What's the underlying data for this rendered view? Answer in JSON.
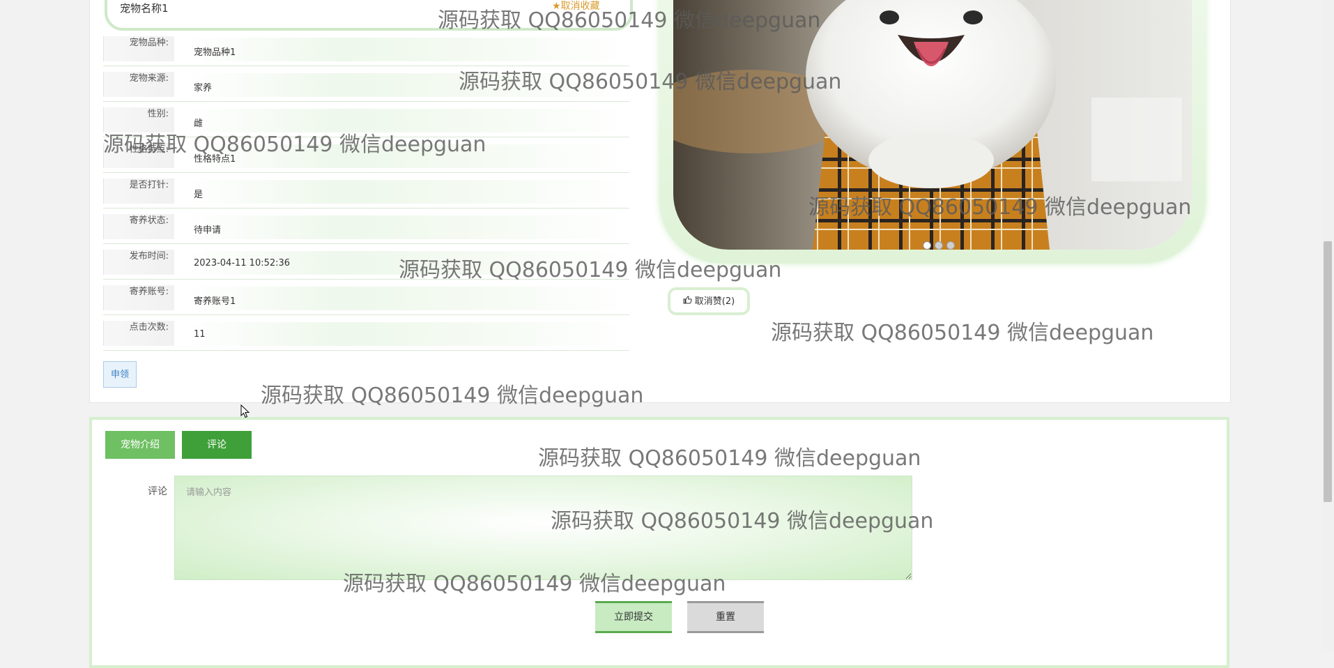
{
  "pet": {
    "name": "宠物名称1",
    "favorite_label": "★取消收藏"
  },
  "fields": [
    {
      "label": "宠物品种:",
      "value": "宠物品种1"
    },
    {
      "label": "宠物来源:",
      "value": "家养"
    },
    {
      "label": "性别:",
      "value": "雌"
    },
    {
      "label": "性格特点:",
      "value": "性格特点1"
    },
    {
      "label": "是否打针:",
      "value": "是"
    },
    {
      "label": "寄养状态:",
      "value": "待申请"
    },
    {
      "label": "发布时间:",
      "value": "2023-04-11 10:52:36"
    },
    {
      "label": "寄养账号:",
      "value": "寄养账号1"
    },
    {
      "label": "点击次数:",
      "value": "11"
    }
  ],
  "actions": {
    "apply_label": "申领",
    "like_label": "取消赞(2)",
    "like_icon": "thumbs-up-icon"
  },
  "carousel": {
    "dot_count": 3,
    "active_index": 0
  },
  "tabs": [
    {
      "label": "宠物介绍"
    },
    {
      "label": "评论"
    }
  ],
  "comment": {
    "label": "评论",
    "placeholder": "请输入内容",
    "submit_label": "立即提交",
    "reset_label": "重置"
  },
  "watermark": "源码获取 QQ86050149 微信deepguan",
  "colors": {
    "accent_green": "#3fa03a",
    "light_green": "#d6efcf",
    "favorite_orange": "#d89b2c",
    "apply_blue": "#3b82c4"
  }
}
